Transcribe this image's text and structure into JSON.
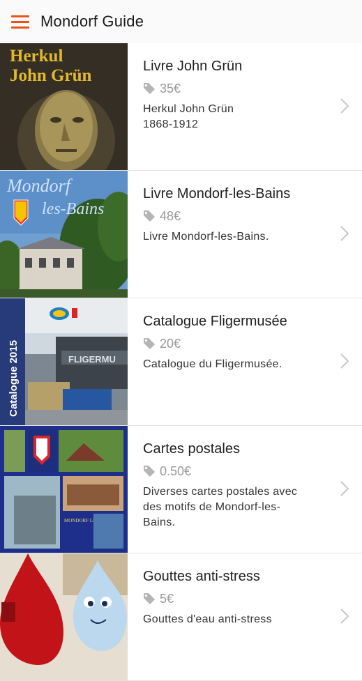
{
  "app": {
    "title": "Mondorf Guide",
    "menu_icon": "hamburger-menu-icon",
    "accent": "#e8541c"
  },
  "items": [
    {
      "title": "Livre John Grün",
      "price": "35€",
      "description": "Herkul John Grün\n1868-1912",
      "thumb_text_1": "Herkul",
      "thumb_text_2": "John Grün"
    },
    {
      "title": "Livre Mondorf-les-Bains",
      "price": "48€",
      "description": "Livre Mondorf-les-Bains.",
      "thumb_text_1": "Mondorf",
      "thumb_text_2": "les-Bains"
    },
    {
      "title": "Catalogue Fligermusée",
      "price": "20€",
      "description": "Catalogue du Fligermusée.",
      "thumb_text_1": "Catalogue 2015",
      "thumb_text_2": "FLIGERMU"
    },
    {
      "title": "Cartes postales",
      "price": "0.50€",
      "description": "Diverses cartes postales avec\ndes motifs de Mondorf-les-\nBains.",
      "thumb_text_1": "MONDORF LES BAINS"
    },
    {
      "title": "Gouttes anti-stress",
      "price": "5€",
      "description": "Gouttes d'eau anti-stress"
    }
  ]
}
